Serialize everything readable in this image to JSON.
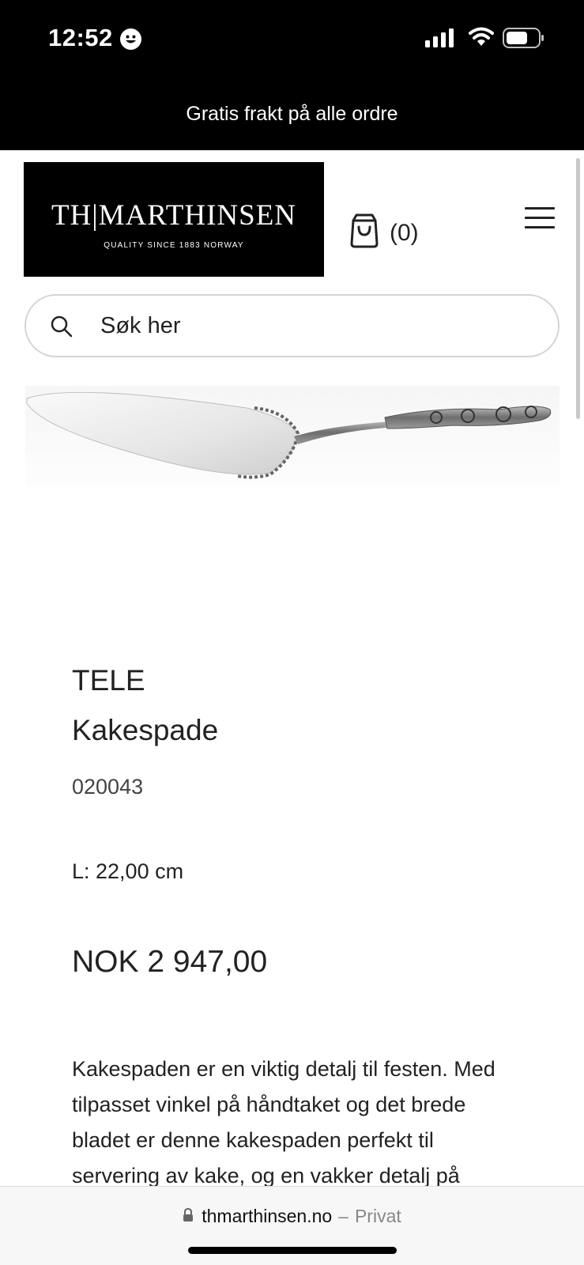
{
  "status_bar": {
    "time": "12:52",
    "icons": [
      "smiley-icon",
      "signal-icon",
      "wifi-icon",
      "battery-icon"
    ]
  },
  "promo": {
    "text": "Gratis frakt på alle ordre"
  },
  "header": {
    "logo_main": "TH|MARTHINSEN",
    "logo_sub": "QUALITY SINCE 1883   NORWAY",
    "cart_count": "(0)",
    "icons": [
      "shopping-bag-icon",
      "hamburger-menu-icon"
    ]
  },
  "search": {
    "placeholder": "Søk her",
    "value": ""
  },
  "product": {
    "collection": "TELE",
    "name": "Kakespade",
    "sku": "020043",
    "length": "L: 22,00 cm",
    "price": "NOK 2 947,00",
    "description": "Kakespaden er en viktig detalj til festen. Med tilpasset vinkel på håndtaket og det brede bladet er denne kakespaden perfekt til servering av kake, og en vakker detalj på"
  },
  "browser": {
    "domain": "thmarthinsen.no",
    "separator": "–",
    "mode": "Privat"
  },
  "colors": {
    "bar_background": "#000000",
    "text": "#222222",
    "search_border": "#d4d4d4",
    "browser_bar": "#f7f7f7"
  }
}
